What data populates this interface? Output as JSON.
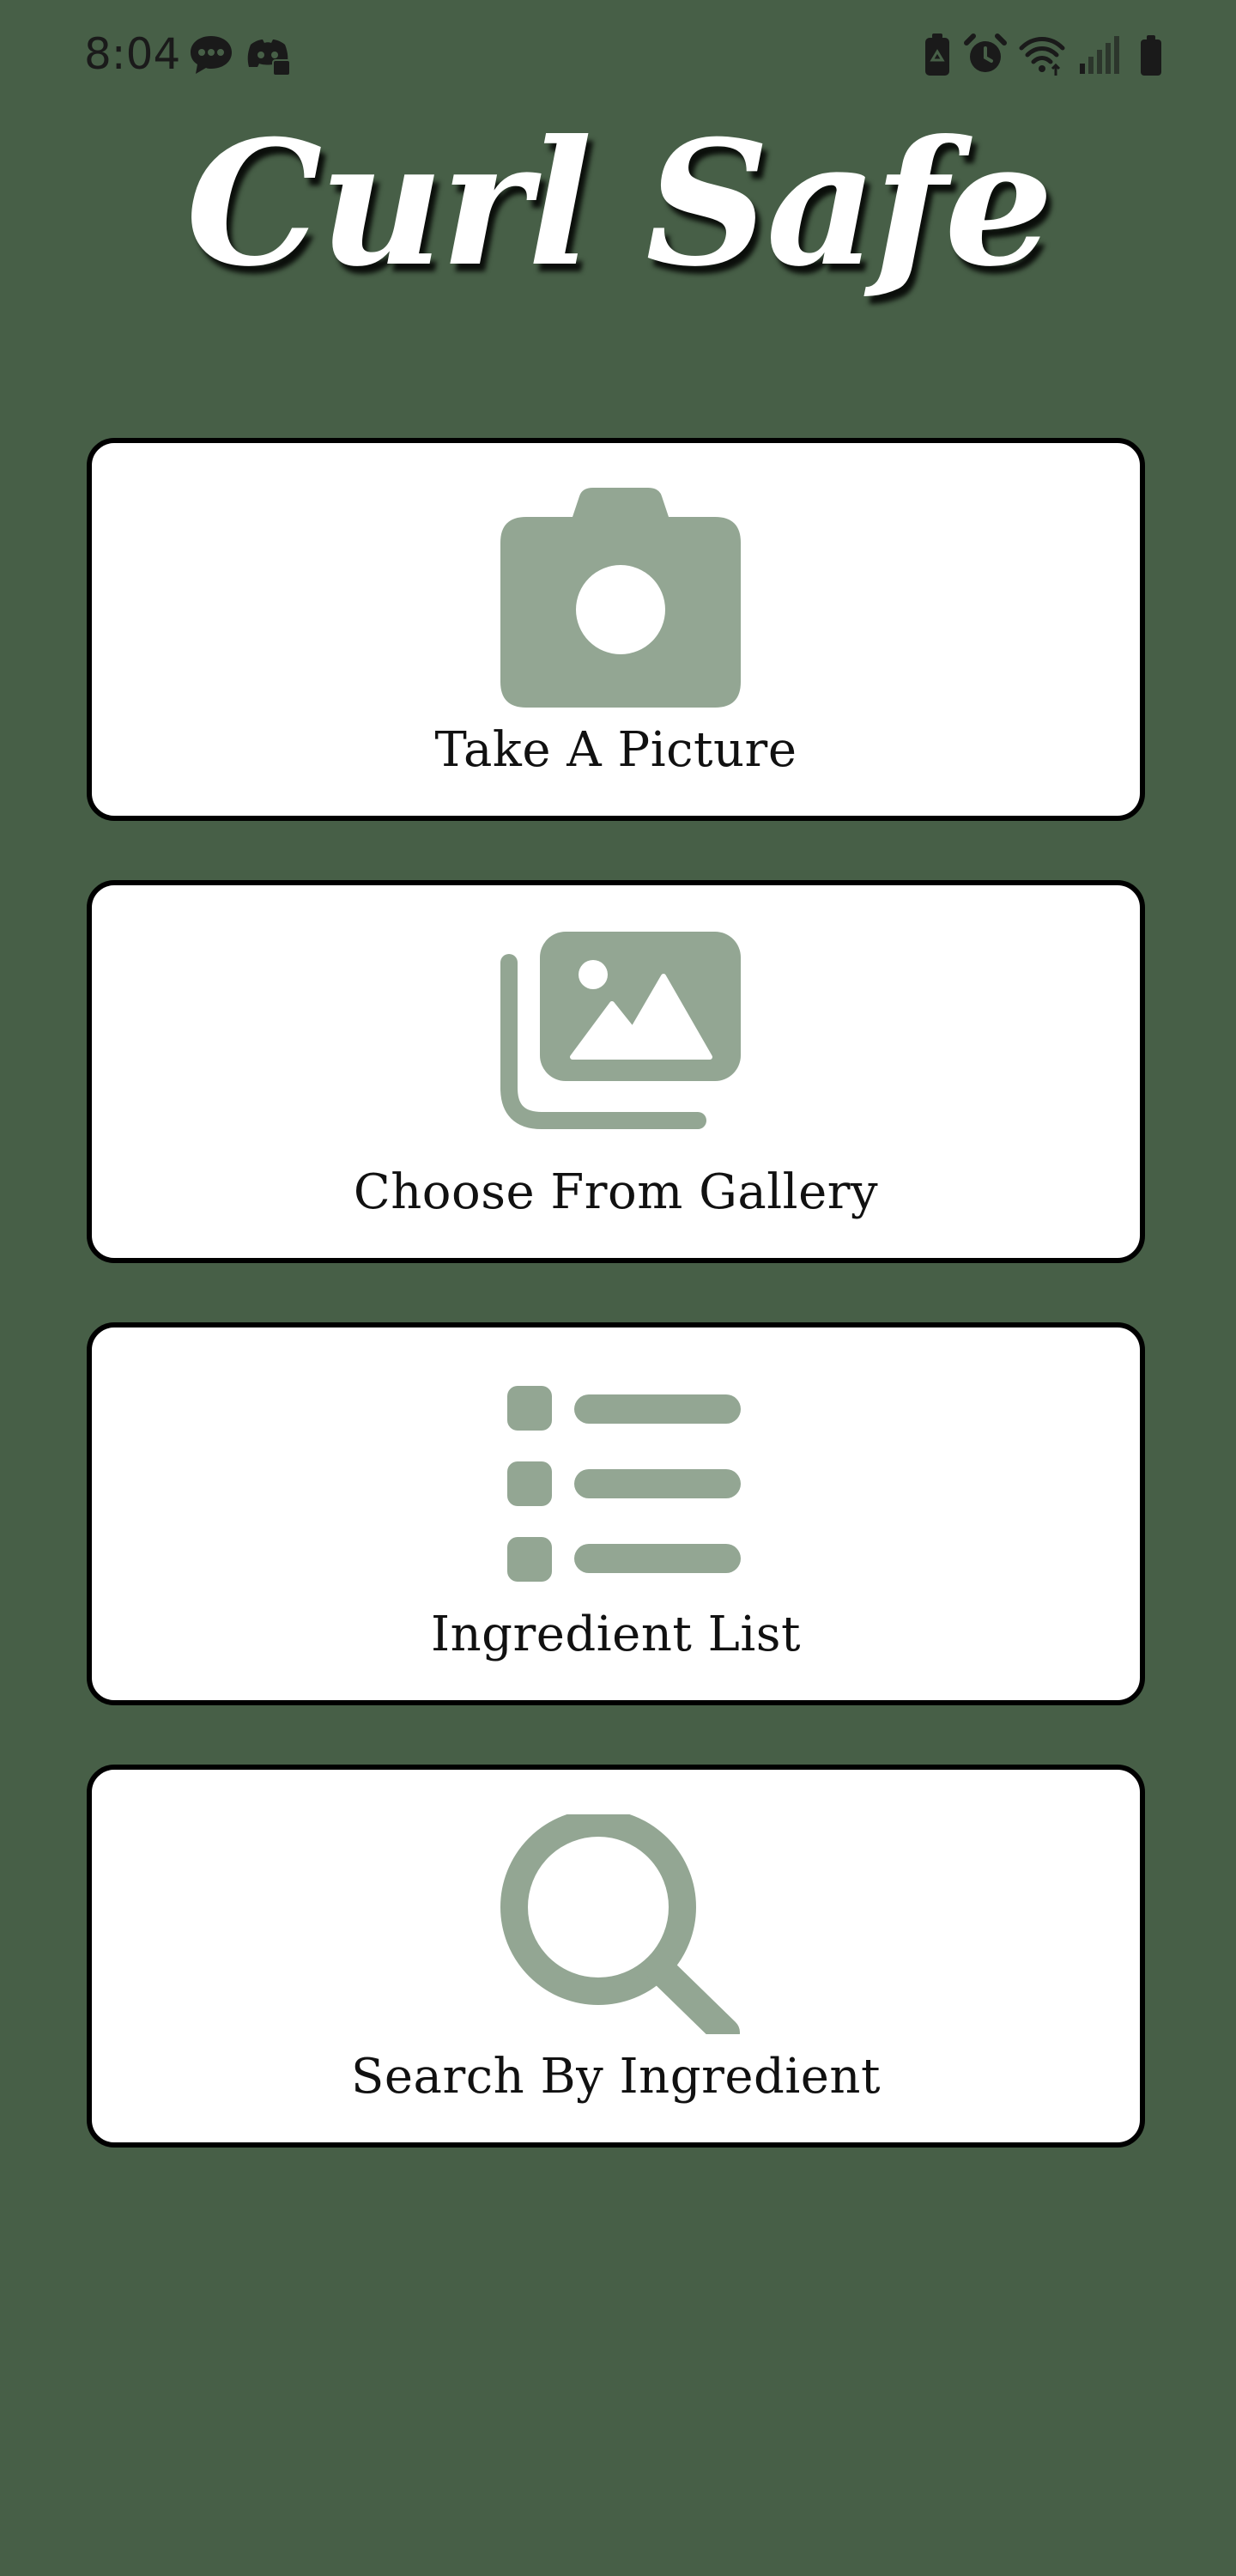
{
  "status_bar": {
    "time": "8:04",
    "left_icons": [
      "chat-bubble-icon",
      "discord-icon"
    ],
    "right_icons": [
      "battery-saver-icon",
      "alarm-icon",
      "wifi-icon",
      "signal-icon",
      "battery-icon"
    ]
  },
  "app": {
    "title": "Curl Safe"
  },
  "menu": {
    "items": [
      {
        "label": "Take A Picture",
        "icon": "camera-icon"
      },
      {
        "label": "Choose From Gallery",
        "icon": "gallery-icon"
      },
      {
        "label": "Ingredient List",
        "icon": "list-icon"
      },
      {
        "label": "Search By Ingredient",
        "icon": "search-icon"
      }
    ]
  },
  "colors": {
    "background": "#475f47",
    "card_background": "#ffffff",
    "icon_color": "#93a693",
    "card_border": "#000000"
  }
}
